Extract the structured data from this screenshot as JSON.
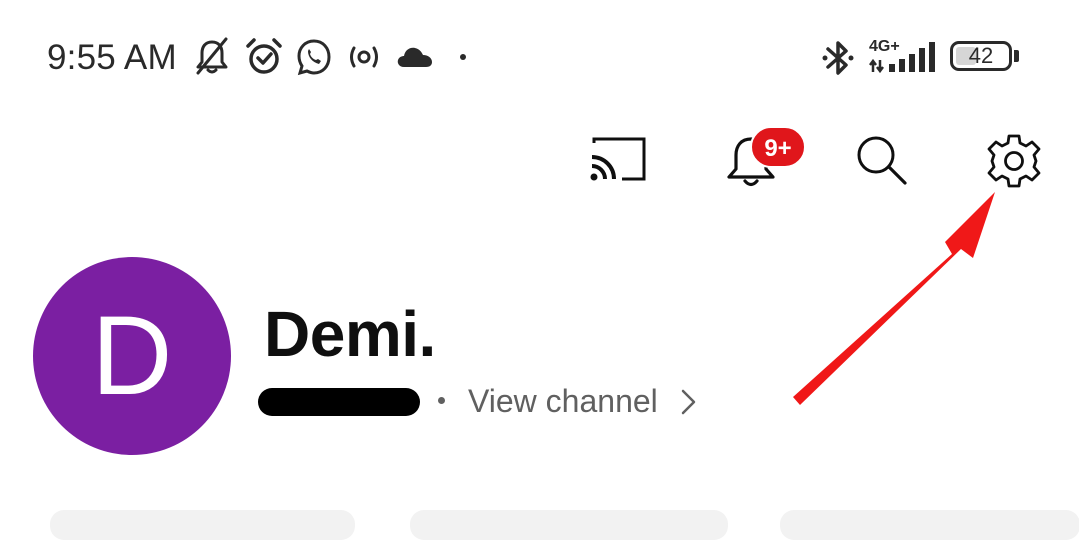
{
  "status_bar": {
    "time": "9:55 AM",
    "network_label": "4G+",
    "battery_level": "42",
    "icons": [
      "mute-notifications-icon",
      "alarm-icon",
      "whatsapp-icon",
      "hotspot-icon",
      "cloud-icon",
      "dot-indicator",
      "bluetooth-icon",
      "signal-icon",
      "battery-icon"
    ]
  },
  "action_bar": {
    "icons": [
      "cast-icon",
      "notifications-icon",
      "search-icon",
      "settings-icon"
    ],
    "notification_badge": "9+",
    "badge_color": "#e0161b"
  },
  "profile": {
    "avatar_letter": "D",
    "avatar_color": "#7b1fa2",
    "name": "Demi.",
    "view_channel_label": "View channel"
  },
  "annotation": {
    "arrow_color": "#f01818",
    "points_to": "settings-icon"
  }
}
